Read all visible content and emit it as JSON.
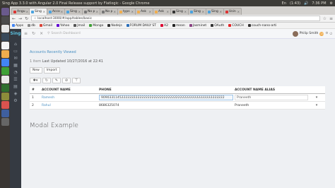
{
  "os": {
    "window_title": "Sing App 3.3.0 with Angular 2.0 Final Release support by Flatlogic - Google Chrome",
    "tray": [
      "En",
      "(1:43)",
      "🔊",
      "7:36 PM",
      "⚙"
    ]
  },
  "browser": {
    "tabs": [
      {
        "label": "Angu",
        "color": "#dd3333",
        "active": false
      },
      {
        "label": "Sing",
        "color": "#4aa3df",
        "active": true
      },
      {
        "label": "Acco",
        "color": "#4aa3df",
        "active": false
      },
      {
        "label": "Sing",
        "color": "#4aa3df",
        "active": false
      },
      {
        "label": "No p",
        "color": "#777777",
        "active": false
      },
      {
        "label": "No p",
        "color": "#777777",
        "active": false
      },
      {
        "label": "typs",
        "color": "#f0ad4e",
        "active": false
      },
      {
        "label": "Ask",
        "color": "#f0ad4e",
        "active": false
      },
      {
        "label": "Ask",
        "color": "#f0ad4e",
        "active": false
      },
      {
        "label": "Sing",
        "color": "#333333",
        "active": false
      },
      {
        "label": "Sing",
        "color": "#4aa3df",
        "active": false
      },
      {
        "label": "Sing",
        "color": "#4aa3df",
        "active": false
      },
      {
        "label": "Usin",
        "color": "#dd3333",
        "active": false
      }
    ],
    "url": "localhost:3000/#/app/tables/basic",
    "bookmarks": [
      {
        "label": "Apps",
        "color": "#4285f4"
      },
      {
        "label": "db",
        "color": "#888888"
      },
      {
        "label": "Gmail",
        "color": "#db4437"
      },
      {
        "label": "Yahoo",
        "color": "#6001d2"
      },
      {
        "label": "Jmail",
        "color": "#555555"
      },
      {
        "label": "Mongo",
        "color": "#3fa037"
      },
      {
        "label": "Nodejs",
        "color": "#333333"
      },
      {
        "label": "FORUM DAILY ST",
        "color": "#2a6ebb"
      },
      {
        "label": "A2",
        "color": "#dd0031"
      },
      {
        "label": "mean",
        "color": "#222222"
      },
      {
        "label": "Jasminet",
        "color": "#8a4182"
      },
      {
        "label": "OAuth",
        "color": "#333333"
      },
      {
        "label": "COUCH",
        "color": "#e42528"
      },
      {
        "label": "couch-nano-arti",
        "color": "#333333"
      }
    ]
  },
  "app": {
    "logo": "Sing",
    "search_placeholder": "Search Dashboard",
    "user_name": "Philip Smith",
    "notification_count": "13",
    "heading": "Accounts Recently Viewed",
    "items_count": "1 item",
    "last_updated": "Last Updated 10/27/2016 at 22:41",
    "new_button": "New",
    "import_button": "Import",
    "table": {
      "headers": {
        "hash": "#",
        "name": "ACCOUNT NAME",
        "phone": "PHONE",
        "alias": "ACCOUNT NAME ALIAS"
      },
      "rows": [
        {
          "num": "1",
          "name": "Ramesh",
          "phone": "9090331145222222222222222222222222222222222222222222222222222",
          "alias": "Praneeth",
          "editing": true
        },
        {
          "num": "2",
          "name": "Rahul",
          "phone": "8686325074",
          "alias": "Praneeth",
          "editing": false
        }
      ]
    },
    "modal_title": "Modal Example"
  }
}
